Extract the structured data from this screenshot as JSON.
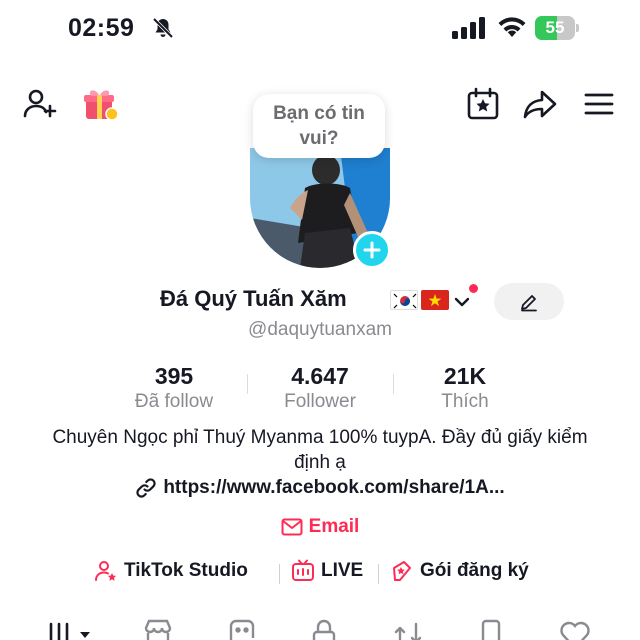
{
  "status_bar": {
    "time": "02:59",
    "battery_percent": 55,
    "battery_label": "55",
    "icons": [
      "bell-slash-icon",
      "cellular-signal-icon",
      "wifi-icon",
      "battery-icon"
    ]
  },
  "top_bar": {
    "icons": [
      "add-friend-icon",
      "gift-icon",
      "calendar-star-icon",
      "share-icon",
      "menu-icon"
    ]
  },
  "profile": {
    "bubble_text": "Bạn có tin vui?",
    "display_name": "Đá Quý Tuấn Xăm",
    "username": "@daquytuanxam",
    "flags": [
      "south-korea-flag",
      "vietnam-flag"
    ]
  },
  "stats": [
    {
      "value": "395",
      "label": "Đã follow"
    },
    {
      "value": "4.647",
      "label": "Follower"
    },
    {
      "value": "21K",
      "label": "Thích"
    }
  ],
  "bio": {
    "text": "Chuyên Ngọc phỉ Thuý Myanma 100% tuypA.   Đầy đủ giấy kiểm định ạ",
    "link": "https://www.facebook.com/share/1A..."
  },
  "email_label": "Email",
  "actions": [
    {
      "label": "TikTok Studio",
      "icon": "studio-icon"
    },
    {
      "label": "LIVE",
      "icon": "live-icon"
    },
    {
      "label": "Gói đăng ký",
      "icon": "subscription-icon"
    }
  ],
  "tabs": [
    "videos-grid-icon",
    "shop-icon",
    "sticker-icon",
    "lock-icon",
    "repost-icon",
    "bookmark-icon",
    "liked-icon"
  ],
  "colors": {
    "accent": "#fe2c55",
    "avatar_plus": "#20d5ec",
    "battery_fill": "#34c759",
    "muted_text": "#8a8b91"
  }
}
